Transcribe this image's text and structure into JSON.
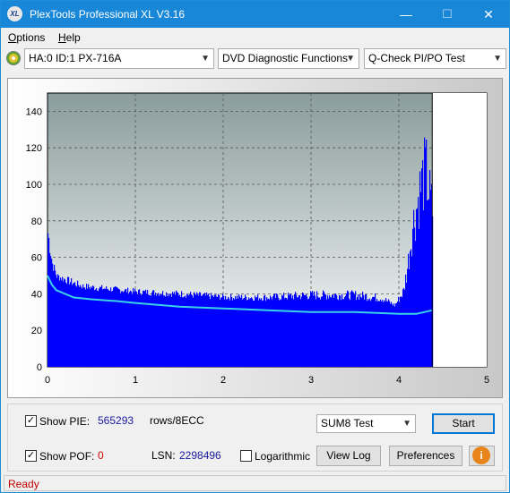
{
  "window": {
    "title": "PlexTools Professional XL V3.16",
    "icon_text": "XL",
    "controls": {
      "minimize": "—",
      "maximize": "☐",
      "close": "✕"
    }
  },
  "menu": {
    "items": [
      {
        "pre": "",
        "hot": "O",
        "post": "ptions"
      },
      {
        "pre": "",
        "hot": "H",
        "post": "elp"
      }
    ]
  },
  "toolbar": {
    "drive": "HA:0 ID:1  PX-716A",
    "function": "DVD Diagnostic Functions",
    "test": "Q-Check PI/PO Test"
  },
  "chart_data": {
    "type": "bar",
    "title": "",
    "xlabel": "",
    "ylabel": "",
    "xlim": [
      0,
      5
    ],
    "ylim": [
      0,
      150
    ],
    "x_ticks": [
      "0",
      "1",
      "2",
      "3",
      "4",
      "5"
    ],
    "y_ticks": [
      "0",
      "20",
      "40",
      "60",
      "80",
      "100",
      "120",
      "140"
    ],
    "grid": true,
    "bar_color": "#0000ff",
    "line_color": "#3ad1e6",
    "data_end_x": 4.38,
    "series": [
      {
        "kind": "bars_envelope",
        "x": [
          0.0,
          0.02,
          0.05,
          0.1,
          0.2,
          0.4,
          0.6,
          0.8,
          1.0,
          1.5,
          2.0,
          2.5,
          3.0,
          3.5,
          3.8,
          3.95,
          4.05,
          4.1,
          4.15,
          4.2,
          4.25,
          4.3,
          4.35,
          4.38
        ],
        "values": [
          80,
          72,
          60,
          52,
          50,
          46,
          45,
          44,
          43,
          42,
          40,
          40,
          42,
          42,
          40,
          35,
          45,
          65,
          90,
          105,
          120,
          130,
          110,
          100
        ]
      },
      {
        "kind": "line",
        "x": [
          0.0,
          0.05,
          0.1,
          0.2,
          0.3,
          0.5,
          0.8,
          1.0,
          1.5,
          2.0,
          2.5,
          3.0,
          3.5,
          4.0,
          4.2,
          4.38
        ],
        "values": [
          50,
          45,
          42,
          40,
          38,
          37,
          36,
          35,
          33,
          32,
          31,
          30,
          30,
          29,
          29,
          31
        ]
      }
    ]
  },
  "bottom": {
    "show_pie_label": "Show PIE:",
    "pie_value": "565293",
    "rows_label": "rows/8ECC",
    "show_pof_label": "Show POF:",
    "pof_value": "0",
    "lsn_label": "LSN:",
    "lsn_value": "2298496",
    "logarithmic_label": "Logarithmic",
    "test_select": "SUM8 Test",
    "start_button": "Start",
    "view_log_button": "View Log",
    "preferences_button": "Preferences",
    "info_icon": "i",
    "show_pie_checked": "✓",
    "show_pof_checked": "✓"
  },
  "status": {
    "text": "Ready"
  }
}
